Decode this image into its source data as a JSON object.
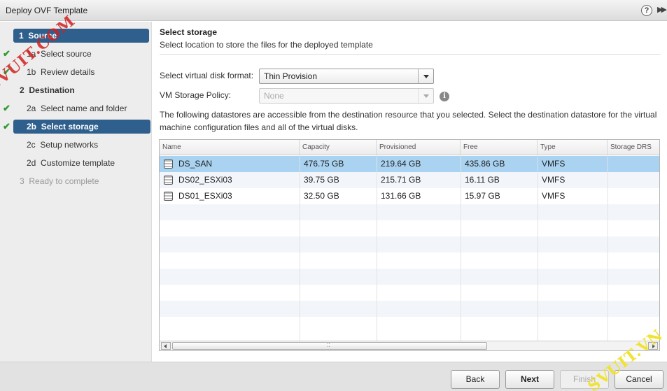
{
  "window": {
    "title": "Deploy OVF Template",
    "help_glyph": "?",
    "expand_glyph": "▶▶"
  },
  "sidebar": {
    "steps": [
      {
        "num": "1",
        "label": "Source",
        "state": "section-active"
      },
      {
        "num": "1a",
        "label": "Select source",
        "state": "completed"
      },
      {
        "num": "1b",
        "label": "Review details",
        "state": "completed"
      },
      {
        "num": "2",
        "label": "Destination",
        "state": "section"
      },
      {
        "num": "2a",
        "label": "Select name and folder",
        "state": "completed"
      },
      {
        "num": "2b",
        "label": "Select storage",
        "state": "current"
      },
      {
        "num": "2c",
        "label": "Setup networks",
        "state": "pending"
      },
      {
        "num": "2d",
        "label": "Customize template",
        "state": "pending"
      },
      {
        "num": "3",
        "label": "Ready to complete",
        "state": "disabled"
      }
    ],
    "check_glyph": "✔"
  },
  "main": {
    "heading": "Select storage",
    "subheading": "Select location to store the files for the deployed template",
    "disk_format": {
      "label": "Select virtual disk format:",
      "value": "Thin Provision"
    },
    "storage_policy": {
      "label": "VM Storage Policy:",
      "value": "None",
      "info_glyph": "i"
    },
    "description": "The following datastores are accessible from the destination resource that you selected. Select the destination datastore for the virtual machine configuration files and all of the virtual disks.",
    "table": {
      "columns": [
        "Name",
        "Capacity",
        "Provisioned",
        "Free",
        "Type",
        "Storage DRS"
      ],
      "rows": [
        {
          "name": "DS_SAN",
          "capacity": "476.75 GB",
          "provisioned": "219.64 GB",
          "free": "435.86 GB",
          "type": "VMFS",
          "drs": "",
          "selected": true
        },
        {
          "name": "DS02_ESXi03",
          "capacity": "39.75 GB",
          "provisioned": "215.71 GB",
          "free": "16.11 GB",
          "type": "VMFS",
          "drs": "",
          "selected": false
        },
        {
          "name": "DS01_ESXi03",
          "capacity": "32.50 GB",
          "provisioned": "131.66 GB",
          "free": "15.97 GB",
          "type": "VMFS",
          "drs": "",
          "selected": false
        }
      ],
      "scroll_grip": "::"
    }
  },
  "footer": {
    "back": "Back",
    "next": "Next",
    "finish": "Finish",
    "cancel": "Cancel"
  },
  "watermarks": {
    "top_left": "SVUIT.COM",
    "bottom_right": "SVUIT.VN"
  },
  "colors": {
    "accent": "#2f5f8c",
    "selected_row": "#a9d3f1",
    "check": "#2e9a31"
  }
}
